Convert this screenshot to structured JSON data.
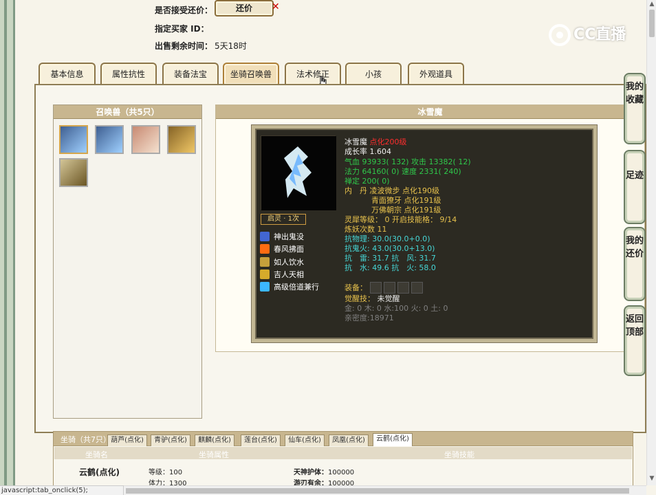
{
  "top_info": {
    "accept_label": "是否接受还价：",
    "counter_button": "还价",
    "buyer_label": "指定买家 ID：",
    "time_label": "出售剩余时间：",
    "time_value": "5天18时"
  },
  "logo_text": "CC直播",
  "tabs": [
    {
      "label": "基本信息",
      "active": false
    },
    {
      "label": "属性抗性",
      "active": false
    },
    {
      "label": "装备法宝",
      "active": false
    },
    {
      "label": "坐骑召唤兽",
      "active": true
    },
    {
      "label": "法术修正",
      "active": false
    },
    {
      "label": "小孩",
      "active": false
    },
    {
      "label": "外观道具",
      "active": false
    }
  ],
  "summon_panel": {
    "title": "召唤兽（共5只）",
    "pets": [
      "ice",
      "ice",
      "mask",
      "dragon",
      "helm"
    ]
  },
  "detail": {
    "title": "冰雪魔",
    "spirit": "启灵 · 1次",
    "skills": [
      "神出鬼没",
      "春风拂面",
      "如人饮水",
      "吉人天相",
      "高级倍道兼行"
    ],
    "name": "冰雪魔",
    "level_text": "点化200级",
    "growth_label": "成长率",
    "growth_value": "1.604",
    "hp_line": "气血 93933( 132) 攻击 13382( 12)",
    "mana_line": "法力 64160( 0) 速度 2331( 240)",
    "calm_line": "禅定 200( 0)",
    "inner_line": "内　丹 凌波微步 点化190级",
    "inner_line2": "青面獠牙 点化191级",
    "inner_line3": "万佛朝宗 点化191级",
    "soul_line": "灵犀等级： 0 开启技能格： 9/14",
    "refine_line": "炼妖次数 11",
    "physical_line": "抗物理: 30.0(30.0+0.0)",
    "ghost_line": "抗鬼火: 43.0(30.0+13.0)",
    "thunder_line": "抗　雷: 31.7 抗　风: 31.7",
    "water_line": "抗　水: 49.6 抗　火: 58.0",
    "equip_label": "装备：",
    "awake_label": "觉醒技：",
    "awake_value": "未觉醒",
    "element_line": "金: 0 木: 0 水:100 火: 0 土: 0",
    "intimacy_line": "亲密度:18971"
  },
  "right_buttons": [
    {
      "label": "我的收藏"
    },
    {
      "label": "足迹"
    },
    {
      "label": "我的还价"
    },
    {
      "label": "返回顶部"
    }
  ],
  "ride": {
    "title": "坐骑（共7只）",
    "tabs": [
      {
        "label": "葫芦(点化)",
        "active": false
      },
      {
        "label": "青驴(点化)",
        "active": false
      },
      {
        "label": "麒麟(点化)",
        "active": false
      },
      {
        "label": "莲台(点化)",
        "active": false
      },
      {
        "label": "仙车(点化)",
        "active": false
      },
      {
        "label": "凤凰(点化)",
        "active": false
      },
      {
        "label": "云鹤(点化)",
        "active": true
      }
    ],
    "columns": [
      "坐骑名",
      "坐骑属性",
      "坐骑技能"
    ],
    "row_name": "云鹤(点化)",
    "level_label": "等级：",
    "level_value": "100",
    "stamina_label": "体力：",
    "stamina_value": "1300",
    "skill1_label": "天神护体：",
    "skill1_value": "100000",
    "skill2_label": "游刃有余：",
    "skill2_value": "100000"
  },
  "status_text": "javascript:tab_onclick(5);"
}
